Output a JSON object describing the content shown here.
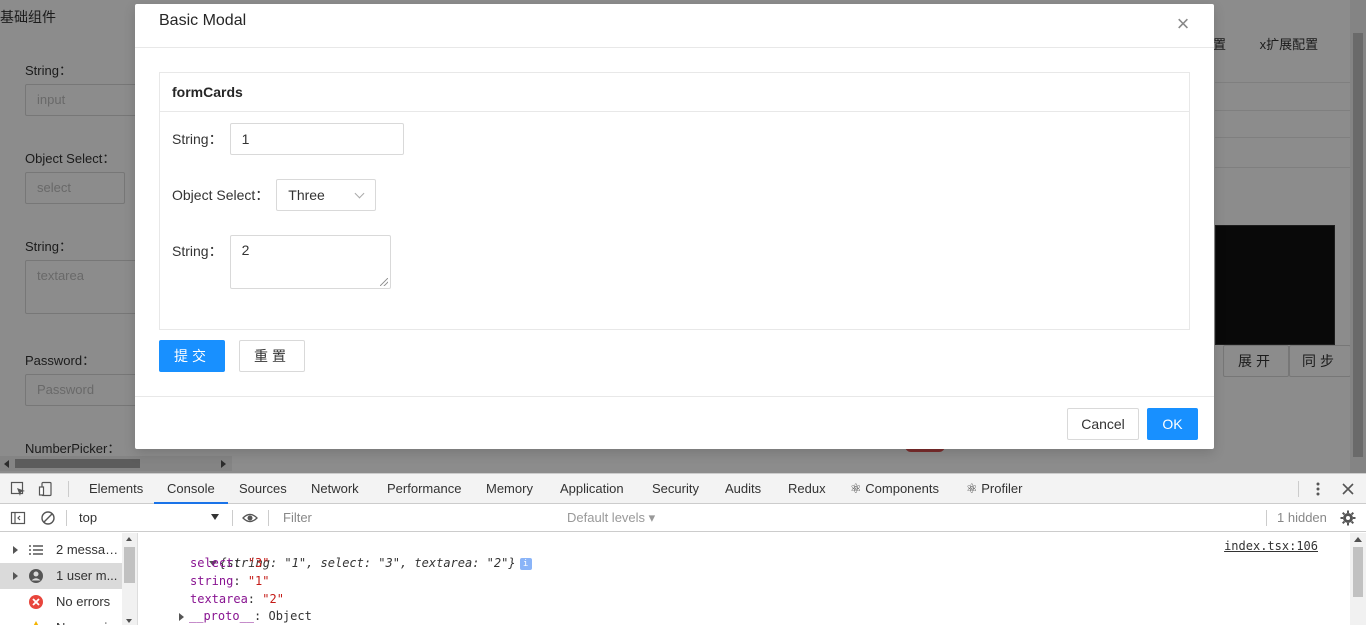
{
  "page": {
    "title": "基础组件",
    "labels": [
      "String：",
      "Object Select：",
      "String：",
      "Password：",
      "NumberPicker："
    ],
    "placeholders": {
      "input": "input",
      "select": "select",
      "textarea": "textarea",
      "password": "Password"
    },
    "right_tabs": [
      "配置",
      "x扩展配置"
    ],
    "buttons": [
      "展开",
      "同步"
    ]
  },
  "modal": {
    "title": "Basic Modal",
    "close_glyph": "×",
    "card_title": "formCards",
    "fields": {
      "string_label": "String：",
      "string_value": "1",
      "select_label": "Object Select：",
      "select_value": "Three",
      "textarea_label": "String：",
      "textarea_value": "2"
    },
    "submit_label": "提交",
    "reset_label": "重置",
    "cancel_label": "Cancel",
    "ok_label": "OK",
    "accent_color": "#1890ff"
  },
  "devtools": {
    "tabs": [
      "Elements",
      "Console",
      "Sources",
      "Network",
      "Performance",
      "Memory",
      "Application",
      "Security",
      "Audits",
      "Redux",
      "⚛ Components",
      "⚛ Profiler"
    ],
    "active_tab": "Console",
    "context": "top",
    "filter_placeholder": "Filter",
    "levels": "Default levels ▾",
    "hidden": "1 hidden",
    "sidebar": [
      {
        "label": "2 messag...",
        "icon": "list-icon"
      },
      {
        "label": "1 user m...",
        "icon": "user-icon"
      },
      {
        "label": "No errors",
        "icon": "error-icon"
      },
      {
        "label": "No warni...",
        "icon": "warning-icon"
      }
    ],
    "console": {
      "summary_open": "{",
      "summary_body": "string: \"1\", select: \"3\", textarea: \"2\"",
      "summary_close": "}",
      "source_link": "index.tsx:106",
      "props": [
        {
          "key": "select",
          "value": "\"3\""
        },
        {
          "key": "string",
          "value": "\"1\""
        },
        {
          "key": "textarea",
          "value": "\"2\""
        }
      ],
      "proto_key": "__proto__",
      "proto_value": "Object"
    }
  }
}
